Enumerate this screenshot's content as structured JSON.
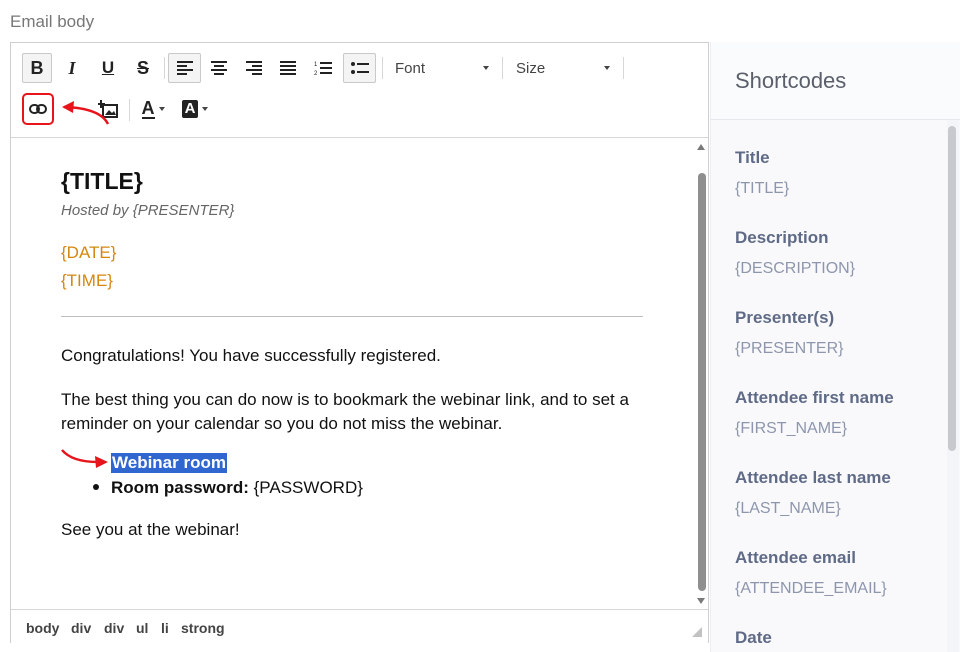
{
  "section_label": "Email body",
  "toolbar": {
    "bold_label": "B",
    "italic_label": "I",
    "underline_label": "U",
    "strike_label": "S",
    "font_select": "Font",
    "size_select": "Size",
    "text_color_label": "A",
    "bg_color_label": "A"
  },
  "document": {
    "title": "{TITLE}",
    "hosted_by": "Hosted by {PRESENTER}",
    "date": "{DATE}",
    "time": "{TIME}",
    "paragraph1": "Congratulations! You have successfully registered.",
    "paragraph2": "The best thing you can do now is to bookmark the webinar link, and to set a reminder on your calendar so you do not miss the webinar.",
    "list_item1": "Webinar room",
    "list_item2_bold": "Room password:",
    "list_item2_value": " {PASSWORD}",
    "paragraph3": "See you at the webinar!"
  },
  "status_path": [
    "body",
    "div",
    "div",
    "ul",
    "li",
    "strong"
  ],
  "shortcodes_panel": {
    "title": "Shortcodes",
    "items": [
      {
        "label": "Title",
        "code": "{TITLE}"
      },
      {
        "label": "Description",
        "code": "{DESCRIPTION}"
      },
      {
        "label": "Presenter(s)",
        "code": "{PRESENTER}"
      },
      {
        "label": "Attendee first name",
        "code": "{FIRST_NAME}"
      },
      {
        "label": "Attendee last name",
        "code": "{LAST_NAME}"
      },
      {
        "label": "Attendee email",
        "code": "{ATTENDEE_EMAIL}"
      },
      {
        "label": "Date",
        "code": ""
      }
    ]
  },
  "colors": {
    "annotation_red": "#e8141b",
    "selection_blue": "#2f66d0",
    "placeholder_orange": "#d4870f"
  }
}
